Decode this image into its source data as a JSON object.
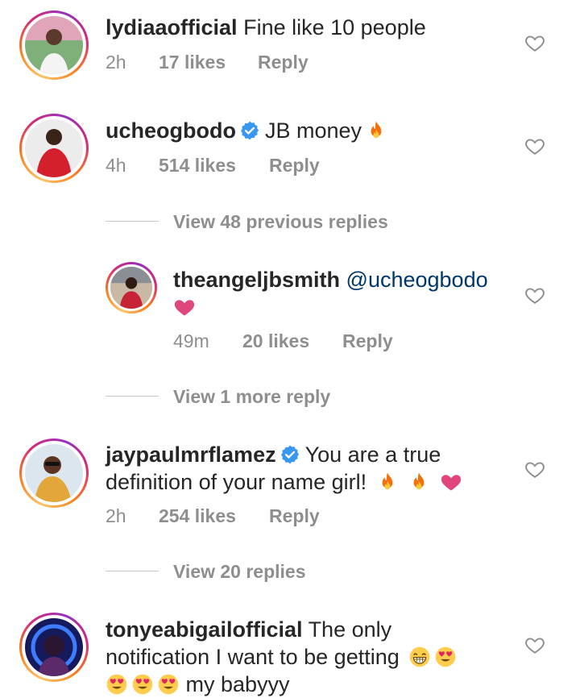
{
  "comments": [
    {
      "username": "lydiaaofficial",
      "text": "Fine like 10 people",
      "time": "2h",
      "likes": "17 likes",
      "reply": "Reply"
    },
    {
      "username": "ucheogbodo",
      "verified": true,
      "text": "JB money",
      "emoji": [
        "fire"
      ],
      "time": "4h",
      "likes": "514 likes",
      "reply": "Reply",
      "view_replies": "View 48 previous replies",
      "replies": [
        {
          "username": "theangeljbsmith",
          "mention": "@ucheogbodo",
          "emoji": [
            "pink-heart"
          ],
          "time": "49m",
          "likes": "20 likes",
          "reply": "Reply"
        }
      ],
      "view_more": "View 1 more reply"
    },
    {
      "username": "jaypaulmrflamez",
      "verified": true,
      "text_line1": "You are a true",
      "text_line2": "definition of your name girl!",
      "emoji": [
        "fire",
        "fire",
        "pink-heart"
      ],
      "time": "2h",
      "likes": "254 likes",
      "reply": "Reply",
      "view_replies": "View 20 replies"
    },
    {
      "username": "tonyeabigailofficial",
      "text_line1": "The only",
      "text_line2": "notification I want to be getting",
      "emoji_line2": [
        "grin-sweat",
        "heart-eyes"
      ],
      "text_line3": "my babyyy",
      "emoji_line3": [
        "heart-eyes",
        "heart-eyes",
        "heart-eyes"
      ]
    }
  ],
  "colors": {
    "text": "#262626",
    "meta": "#8e8e8e",
    "mention": "#00376b",
    "verified": "#3897f0",
    "heart": "#e0467c"
  }
}
